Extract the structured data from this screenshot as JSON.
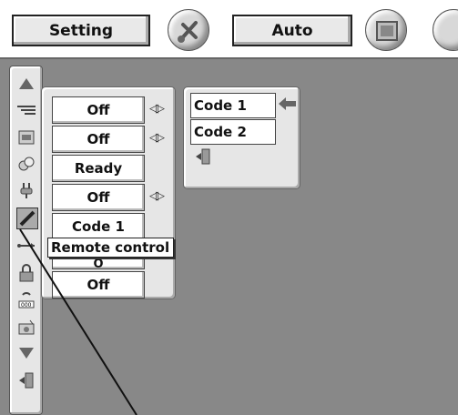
{
  "topbar": {
    "setting_label": "Setting",
    "auto_label": "Auto",
    "icons": [
      "tools-icon",
      "screen-icon",
      "more-icon"
    ]
  },
  "sidebar": {
    "icons": [
      "scroll-up-icon",
      "pc-adjust-icon",
      "image-adjust-icon",
      "image-select-icon",
      "power-icon",
      "remote-control-icon",
      "usb-icon",
      "security-icon",
      "lamp-counter-icon",
      "filter-icon",
      "scroll-down-icon",
      "exit-icon"
    ]
  },
  "main_panel": {
    "values": [
      "Off",
      "Off",
      "Ready",
      "Off",
      "Code 1",
      "",
      "Off"
    ],
    "hidden_value_fragment": "O"
  },
  "tooltip": {
    "label": "Remote control"
  },
  "code_menu": {
    "items": [
      "Code 1",
      "Code 2"
    ],
    "selected": "Code 1"
  },
  "colors": {
    "screen": "#888888",
    "panel": "#e6e6e6"
  }
}
